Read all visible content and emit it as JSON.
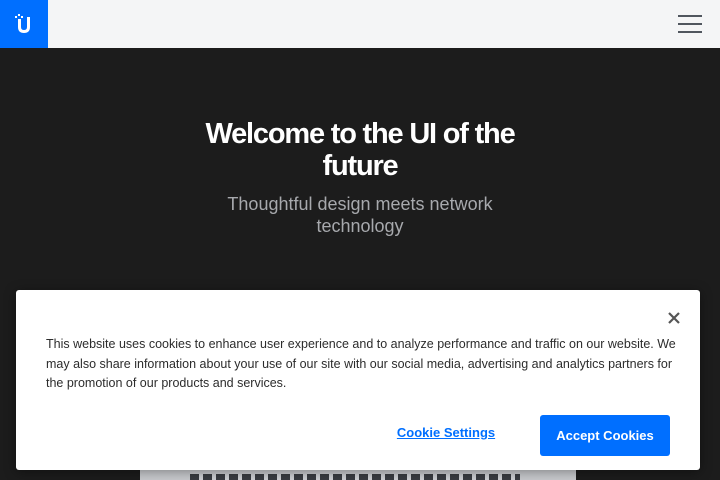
{
  "header": {
    "logo_icon": "ubiquiti-u-logo-icon",
    "menu_icon": "hamburger-menu-icon",
    "brand_color": "#006fff"
  },
  "hero": {
    "title": "Welcome to the UI of the future",
    "subtitle": "Thoughtful design meets network technology"
  },
  "cookie_banner": {
    "text": "This website uses cookies to enhance user experience and to analyze performance and traffic on our website. We may also share information about your use of our site with our social media, advertising and analytics partners for the promotion of our products and services.",
    "settings_label": "Cookie Settings",
    "accept_label": "Accept Cookies",
    "close_icon": "close-icon",
    "accent_color": "#006fff"
  }
}
